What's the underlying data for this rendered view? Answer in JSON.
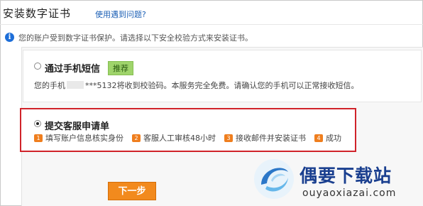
{
  "header": {
    "title": "安装数字证书",
    "help_link": "使用遇到问题?"
  },
  "info": {
    "icon": "info-icon",
    "text": "您的账户受到数字证书保护。请选择以下安全校验方式来安装证书。"
  },
  "options": {
    "sms": {
      "title": "通过手机短信",
      "badge": "推荐",
      "desc_prefix": "您的手机",
      "desc_suffix": "***5132将收到校验码。本服务完全免费。请确认您的手机可以正常接收短信。"
    },
    "support": {
      "title": "提交客服申请单",
      "steps": [
        {
          "num": "1",
          "label": "填写账户信息核实身份"
        },
        {
          "num": "2",
          "label": "客服人工审核48小时"
        },
        {
          "num": "3",
          "label": "接收邮件并安装证书"
        },
        {
          "num": "4",
          "label": "成功"
        }
      ]
    }
  },
  "actions": {
    "next": "下一步"
  },
  "watermark": {
    "brand": "偶要下载站",
    "url": "ouyaoxiazai.com"
  },
  "colors": {
    "highlight_border": "#d0232a",
    "button": "#f28a1d",
    "badge": "#9fd46b",
    "link": "#1b5fb5"
  }
}
